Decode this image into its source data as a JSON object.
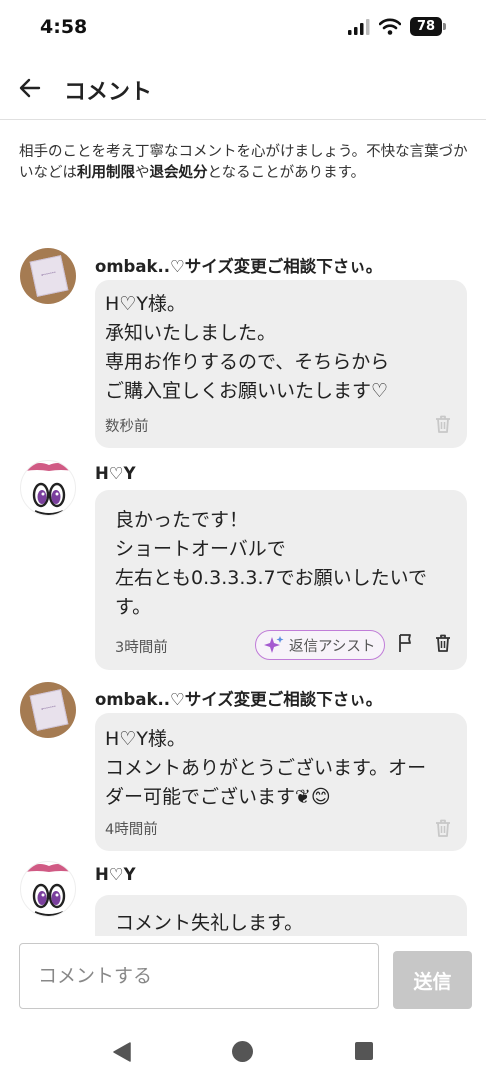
{
  "status_bar": {
    "time": "4:58",
    "battery": "78"
  },
  "header": {
    "title": "コメント"
  },
  "notice": {
    "part1": "相手のことを考え丁寧なコメントを心がけましょう。不快な言葉づかいなどは",
    "bold1": "利用制限",
    "part2": "や",
    "bold2": "退会処分",
    "part3": "となることがあります。"
  },
  "comments": [
    {
      "name": "ombak..♡サイズ変更ご相談下さぃ。",
      "text": "H♡Y様。\n承知いたしました。\n専用お作りするので、そちらから\nご購入宜しくお願いいたします♡",
      "time": "数秒前"
    },
    {
      "name": "H♡Y",
      "text": "良かったです！\nショートオーバルで\n左右とも0.3.3.3.7でお願いしたいで\nす。",
      "time": "3時間前",
      "assist_label": "返信アシスト"
    },
    {
      "name": "ombak..♡サイズ変更ご相談下さぃ。",
      "text": "H♡Y様。\nコメントありがとうございます。オー\nダー可能でございます❦😊",
      "time": "4時間前"
    },
    {
      "name": "H♡Y",
      "text": "コメント失礼します。"
    }
  ],
  "input": {
    "placeholder": "コメントする",
    "value": ""
  },
  "send_label": "送信",
  "colors": {
    "bubble": "#eeeeee",
    "send_disabled": "#c7c7c7",
    "assist_border": "#c07cd8"
  }
}
